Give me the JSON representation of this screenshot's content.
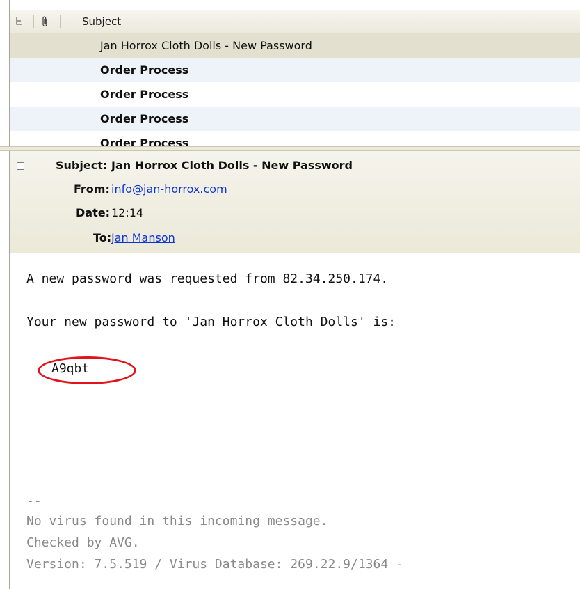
{
  "list": {
    "columns": {
      "thread_icon": "thread-icon",
      "attachment_icon": "paperclip-icon",
      "subject": "Subject"
    },
    "rows": [
      {
        "subject": "Jan Horrox Cloth Dolls - New Password"
      },
      {
        "subject": "Order Process"
      },
      {
        "subject": "Order Process"
      },
      {
        "subject": "Order Process"
      },
      {
        "subject": "Order Process"
      }
    ]
  },
  "header": {
    "subject_label": "Subject:",
    "subject": "Jan Horrox Cloth Dolls - New Password",
    "from_label": "From:",
    "from": "info@jan-horrox.com",
    "date_label": "Date:",
    "date": "12:14",
    "to_label": "To:",
    "to": "Jan Manson"
  },
  "body": {
    "line1": "A new password was requested from 82.34.250.174.",
    "line2": "Your new password to 'Jan Horrox Cloth Dolls' is:",
    "password": "A9qbt",
    "sig_sep": "--",
    "sig1": "No virus found in this incoming message.",
    "sig2": "Checked by AVG.",
    "sig3": "Version: 7.5.519 / Virus Database: 269.22.9/1364 -"
  },
  "colors": {
    "highlight_circle": "#e1131c",
    "link": "#0a34d8",
    "selected_row": "#e4e0cf"
  }
}
